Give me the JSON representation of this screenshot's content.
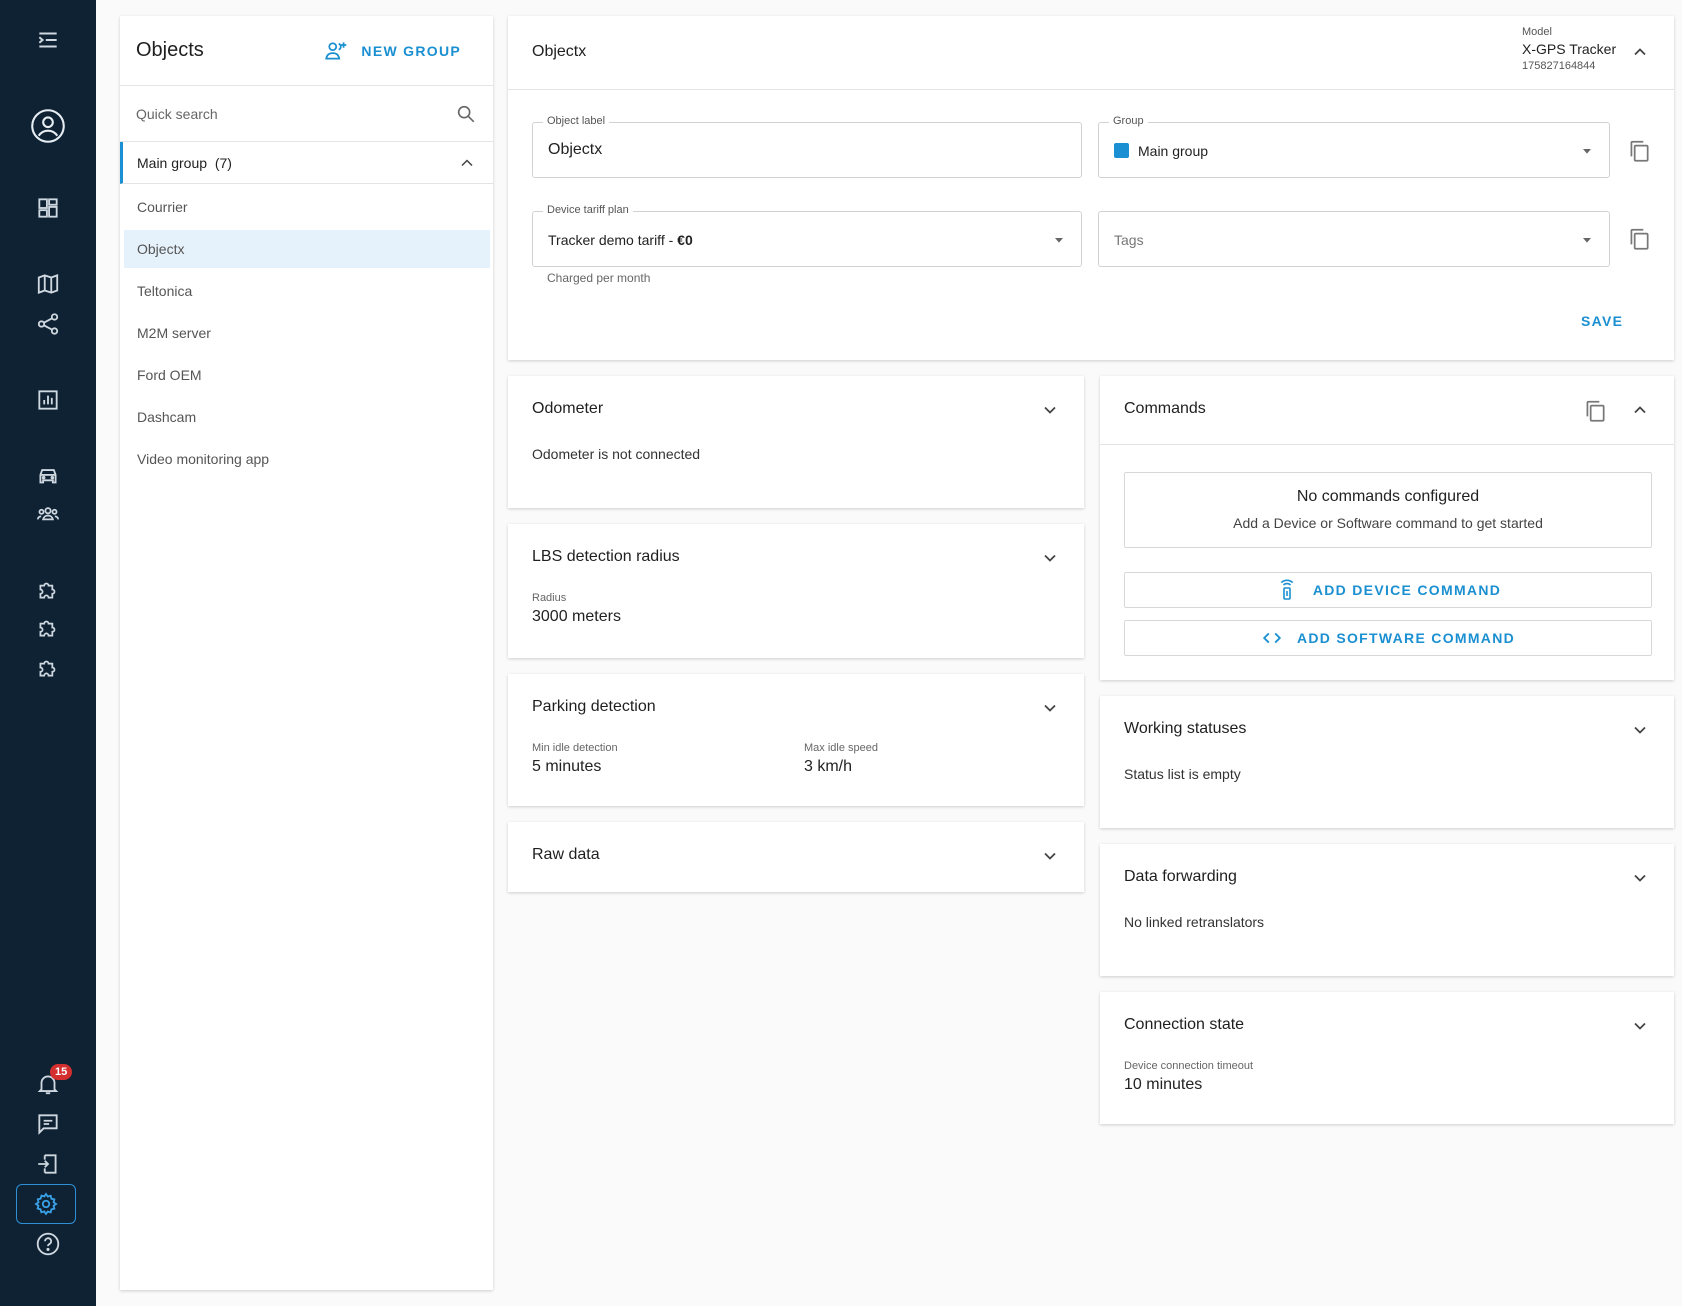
{
  "nav": {
    "items": [
      "menu-toggle",
      "profile",
      "dashboard",
      "map",
      "share",
      "reports",
      "vehicles",
      "users",
      "plugin-1",
      "plugin-2",
      "plugin-3",
      "notifications",
      "messages",
      "logout",
      "settings",
      "help"
    ],
    "notifications_count": "15"
  },
  "sidebar": {
    "title": "Objects",
    "new_group_label": "NEW GROUP",
    "search_placeholder": "Quick search",
    "group": {
      "label": "Main group",
      "count": "(7)"
    },
    "objects": [
      "Courrier",
      "Objectx",
      "Teltonica",
      "M2M server",
      "Ford OEM",
      "Dashcam",
      "Video monitoring app"
    ],
    "selected": "Objectx"
  },
  "object_card": {
    "title": "Objectx",
    "model_label": "Model",
    "model_name": "X-GPS Tracker",
    "model_id": "175827164844",
    "object_label_label": "Object label",
    "object_label_value": "Objectx",
    "group_label": "Group",
    "group_value": "Main group",
    "tariff_label": "Device tariff plan",
    "tariff_value_prefix": "Tracker demo tariff - ",
    "tariff_value_price": "€0",
    "tariff_helper": "Charged per month",
    "tags_placeholder": "Tags",
    "save_label": "SAVE"
  },
  "odometer": {
    "title": "Odometer",
    "text": "Odometer is not connected"
  },
  "lbs": {
    "title": "LBS detection radius",
    "radius_label": "Radius",
    "radius_value": "3000 meters"
  },
  "parking": {
    "title": "Parking detection",
    "idle_label": "Min idle detection",
    "idle_value": "5 minutes",
    "speed_label": "Max idle speed",
    "speed_value": "3 km/h"
  },
  "raw": {
    "title": "Raw data"
  },
  "commands": {
    "title": "Commands",
    "empty_title": "No commands configured",
    "empty_sub": "Add a Device or Software command to get started",
    "add_device": "ADD DEVICE COMMAND",
    "add_software": "ADD SOFTWARE COMMAND"
  },
  "working": {
    "title": "Working statuses",
    "text": "Status list is empty"
  },
  "forwarding": {
    "title": "Data forwarding",
    "text": "No linked retranslators"
  },
  "connection": {
    "title": "Connection state",
    "timeout_label": "Device connection timeout",
    "timeout_value": "10 minutes"
  },
  "colors": {
    "accent": "#1a8fd1",
    "rail": "#0f2233",
    "badge": "#d32f2f"
  }
}
